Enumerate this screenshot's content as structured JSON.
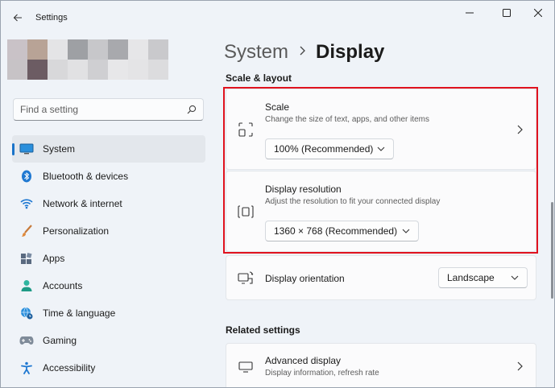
{
  "window": {
    "title": "Settings"
  },
  "search": {
    "placeholder": "Find a setting"
  },
  "nav": {
    "items": [
      {
        "label": "System",
        "icon": "monitor-icon",
        "active": true
      },
      {
        "label": "Bluetooth & devices",
        "icon": "bluetooth-icon"
      },
      {
        "label": "Network & internet",
        "icon": "wifi-icon"
      },
      {
        "label": "Personalization",
        "icon": "brush-icon"
      },
      {
        "label": "Apps",
        "icon": "apps-icon"
      },
      {
        "label": "Accounts",
        "icon": "person-icon"
      },
      {
        "label": "Time & language",
        "icon": "globe-clock-icon"
      },
      {
        "label": "Gaming",
        "icon": "gamepad-icon"
      },
      {
        "label": "Accessibility",
        "icon": "accessibility-icon"
      }
    ]
  },
  "breadcrumb": {
    "parent": "System",
    "current": "Display"
  },
  "scale_layout": {
    "title": "Scale & layout",
    "scale": {
      "title": "Scale",
      "description": "Change the size of text, apps, and other items",
      "value": "100% (Recommended)"
    },
    "resolution": {
      "title": "Display resolution",
      "description": "Adjust the resolution to fit your connected display",
      "value": "1360 × 768 (Recommended)"
    },
    "orientation": {
      "title": "Display orientation",
      "value": "Landscape"
    }
  },
  "related": {
    "title": "Related settings",
    "advanced": {
      "title": "Advanced display",
      "description": "Display information, refresh rate"
    }
  },
  "colors": {
    "accent": "#1a73c9",
    "highlight": "#e0121e"
  }
}
